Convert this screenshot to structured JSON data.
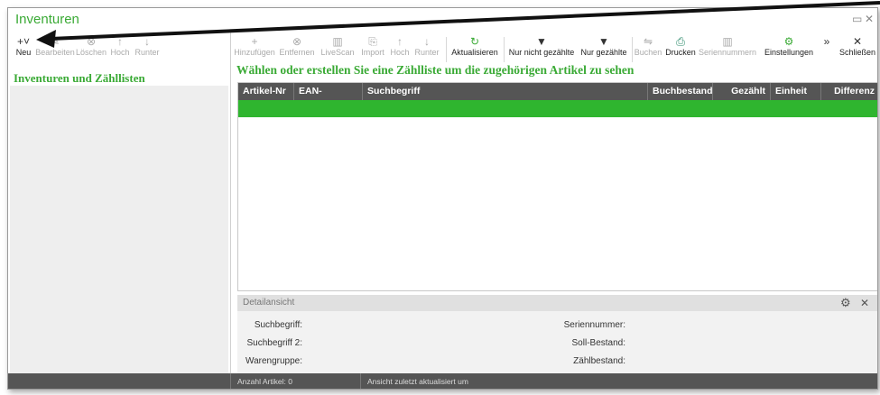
{
  "window": {
    "title": "Inventuren",
    "restore_icon": "restore-icon",
    "close_icon": "close-icon"
  },
  "left_toolbar": [
    {
      "label": "Neu",
      "icon": "plus-icon",
      "enabled": true
    },
    {
      "label": "Bearbeiten",
      "icon": "edit-icon",
      "enabled": false
    },
    {
      "label": "Löschen",
      "icon": "delete-icon",
      "enabled": false
    },
    {
      "label": "Hoch",
      "icon": "arrow-up-icon",
      "enabled": false
    },
    {
      "label": "Runter",
      "icon": "arrow-down-icon",
      "enabled": false
    }
  ],
  "left_section_title": "Inventuren und Zähllisten",
  "right_toolbar": [
    {
      "label": "Hinzufügen",
      "icon": "plus-icon",
      "enabled": false
    },
    {
      "label": "Entfernen",
      "icon": "remove-icon",
      "enabled": false
    },
    {
      "label": "LiveScan",
      "icon": "barcode-icon",
      "enabled": false
    },
    {
      "label": "Import",
      "icon": "import-icon",
      "enabled": false
    },
    {
      "label": "Hoch",
      "icon": "arrow-up-icon",
      "enabled": false
    },
    {
      "label": "Runter",
      "icon": "arrow-down-icon",
      "enabled": false
    },
    {
      "label": "Aktualisieren",
      "icon": "refresh-icon",
      "enabled": true
    },
    {
      "label": "Nur nicht gezählte",
      "icon": "filter-icon",
      "enabled": true
    },
    {
      "label": "Nur gezählte",
      "icon": "filter-icon",
      "enabled": true
    },
    {
      "label": "Buchen",
      "icon": "book-icon",
      "enabled": false
    },
    {
      "label": "Drucken",
      "icon": "printer-icon",
      "enabled": true
    },
    {
      "label": "Seriennummern",
      "icon": "barcode-icon",
      "enabled": false
    },
    {
      "label": "Einstellungen",
      "icon": "settings-icon",
      "enabled": true
    },
    {
      "label": "Schließen",
      "icon": "close-icon",
      "enabled": true
    }
  ],
  "main_heading": "Wählen oder erstellen Sie eine Zählliste um die zugehörigen Artikel zu sehen",
  "grid": {
    "columns": [
      "Artikel-Nr",
      "EAN-Nummer",
      "Suchbegriff",
      "Buchbestand",
      "Gezählt",
      "Einheit",
      "Differenz"
    ]
  },
  "detail": {
    "title": "Detailansicht",
    "left_labels": [
      "Suchbegriff:",
      "Suchbegriff 2:",
      "Warengruppe:"
    ],
    "right_labels": [
      "Seriennummer:",
      "Soll-Bestand:",
      "Zählbestand:"
    ]
  },
  "status": {
    "count": "Anzahl Artikel: 0",
    "updated": "Ansicht zuletzt aktualisiert um"
  },
  "colors": {
    "accent": "#3aaa35",
    "header": "#555555",
    "selection": "#2fb52f"
  }
}
